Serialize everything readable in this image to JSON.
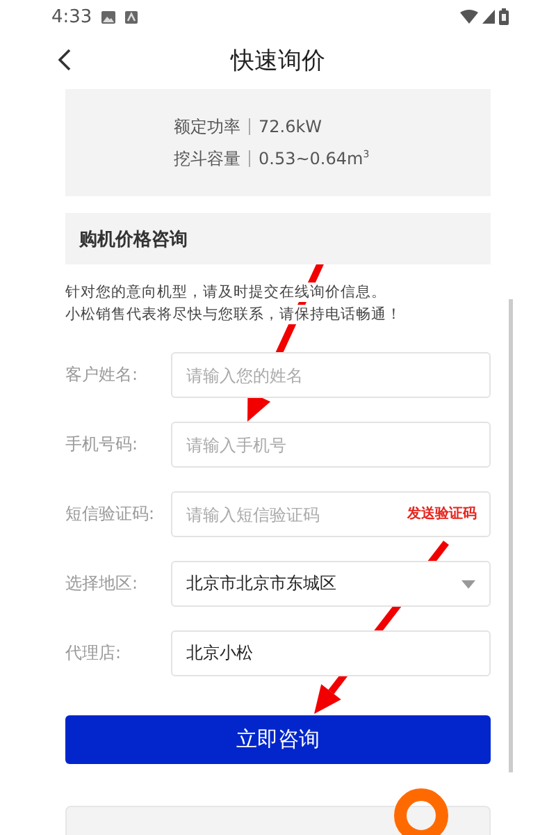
{
  "status_bar": {
    "time": "4:33"
  },
  "header": {
    "title": "快速询价"
  },
  "specs": [
    {
      "label": "额定功率",
      "value": "72.6kW"
    },
    {
      "label": "挖斗容量",
      "value": "0.53~0.64m$^{3}$"
    }
  ],
  "section": {
    "title": "购机价格咨询"
  },
  "intro": [
    "针对您的意向机型，请及时提交在线询价信息。",
    "小松销售代表将尽快与您联系，请保持电话畅通！"
  ],
  "fields": [
    {
      "kind": "input",
      "label": "客户姓名:",
      "placeholder": "请输入您的姓名"
    },
    {
      "kind": "input",
      "label": "手机号码:",
      "placeholder": "请输入手机号"
    },
    {
      "kind": "code",
      "label": "短信验证码:",
      "placeholder": "请输入短信验证码",
      "action": "发送验证码"
    },
    {
      "kind": "select",
      "label": "选择地区:",
      "value": "北京市北京市东城区"
    },
    {
      "kind": "input",
      "label": "代理店:",
      "value": "北京小松"
    }
  ],
  "submit": {
    "label": "立即咨询"
  },
  "annotations": [
    {
      "kind": "arrow"
    },
    {
      "kind": "arrow"
    }
  ]
}
